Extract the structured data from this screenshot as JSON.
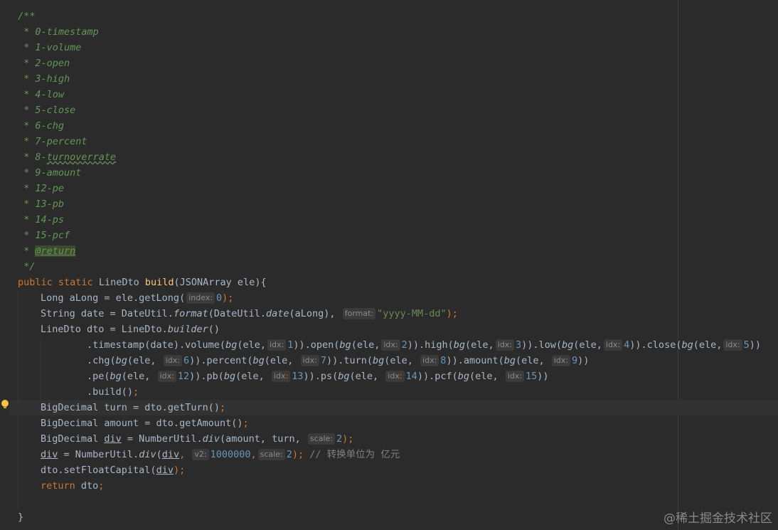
{
  "doc": {
    "open": "/**",
    "lines": [
      "0-timestamp",
      "1-volume",
      "2-open",
      "3-high",
      "4-low",
      "5-close",
      "6-chg",
      "7-percent",
      "8-",
      "9-amount",
      "12-pe",
      "13-pb",
      "14-ps",
      "15-pcf"
    ],
    "turnover_word": "turnoverrate",
    "star": " * ",
    "return_tag": "@return",
    "close": " */"
  },
  "sig": {
    "public": "public",
    "static": "static",
    "return_type": "LineDto",
    "method": "build",
    "params": "(JSONArray ele){"
  },
  "l1": {
    "pre": "Long aLong = ele.getLong(",
    "hint": "index:",
    "num": "0",
    "end": ");"
  },
  "l2": {
    "pre": "String date = DateUtil.",
    "fmt": "format",
    "mid": "(DateUtil.",
    "date": "date",
    "arg": "(aLong),",
    "hint": "format:",
    "str": "\"yyyy-MM-dd\"",
    "end": ");"
  },
  "l3": {
    "pre": "LineDto dto = LineDto.",
    "builder": "builder",
    "end": "()"
  },
  "chain1": {
    "a": ".timestamp(date).volume(",
    "bg": "bg",
    "e": "(ele,",
    "idx": "idx:",
    "n1": "1",
    "b": ")).open(",
    "n2": "2",
    "c": ")).high(",
    "n3": "3",
    "d": ")).low(",
    "n4": "4",
    "f": ")).close(",
    "n5": "5",
    "end": "))"
  },
  "chain2": {
    "a": ".chg(",
    "n6": "6",
    "b": ")).percent(",
    "n7": "7",
    "c": ")).turn(",
    "n8": "8",
    "d": ")).amount(",
    "n9": "9",
    "end": "))"
  },
  "chain3": {
    "a": ".pe(",
    "n12": "12",
    "b": ")).pb(",
    "n13": "13",
    "c": ")).ps(",
    "n14": "14",
    "d": ")).pcf(",
    "n15": "15",
    "end": "))"
  },
  "chain4": {
    "build": ".build()",
    "semi": ";"
  },
  "l4": {
    "text": "BigDecimal turn = dto.getTurn()",
    "semi": ";"
  },
  "l5": {
    "text": "BigDecimal amount = dto.getAmount()",
    "semi": ";"
  },
  "l6": {
    "pre": "BigDecimal ",
    "var": "div",
    "mid": " = NumberUtil.",
    "fn": "div",
    "args": "(amount, turn,",
    "hint": "scale:",
    "num": "2",
    "end": ");"
  },
  "l7": {
    "var": "div",
    "mid": " = NumberUtil.",
    "fn": "div",
    "open": "(",
    "arg": "div",
    "comma": ",",
    "hint1": "v2:",
    "num1": "1000000",
    "comma2": ",",
    "hint2": "scale:",
    "num2": "2",
    "end": ");",
    "comment": " // 转换单位为 亿元"
  },
  "l8": {
    "pre": "dto.setFloatCapital(",
    "var": "div",
    "end": ");"
  },
  "l9": {
    "kw": "return",
    "rest": " dto",
    "semi": ";"
  },
  "closing_brace": "}",
  "watermark": "@稀土掘金技术社区",
  "colors": {
    "background": "#2b2b2b",
    "keyword": "#cc7832",
    "comment": "#629755",
    "number": "#6897bb",
    "string": "#6a8759",
    "method": "#ffc66d",
    "text": "#a9b7c6"
  }
}
